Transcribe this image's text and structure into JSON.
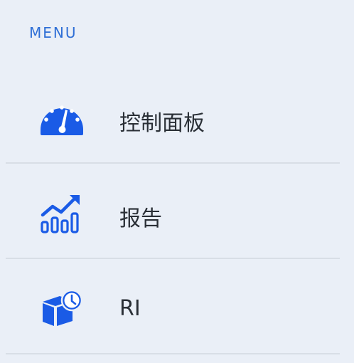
{
  "menu": {
    "header": "MENU",
    "items": [
      {
        "label": "控制面板",
        "icon": "dashboard-gauge-icon"
      },
      {
        "label": "报告",
        "icon": "report-chart-icon"
      },
      {
        "label": "RI",
        "icon": "box-clock-icon"
      }
    ]
  },
  "colors": {
    "background": "#eaeff7",
    "accent": "#1a5be6",
    "header_text": "#2f6fd6",
    "label_text": "#2a2f36",
    "divider": "#d8dee6"
  }
}
